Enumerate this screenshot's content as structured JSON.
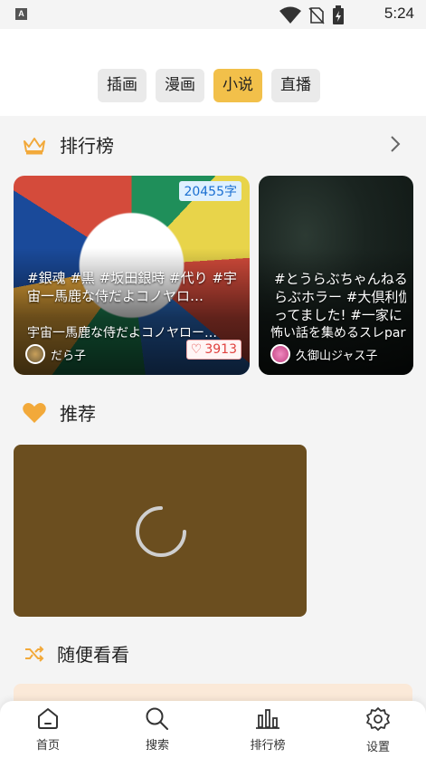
{
  "status_bar": {
    "app_badge": "A",
    "time": "5:24"
  },
  "tabs": [
    {
      "label": "插画",
      "active": false
    },
    {
      "label": "漫画",
      "active": false
    },
    {
      "label": "小说",
      "active": true
    },
    {
      "label": "直播",
      "active": false
    }
  ],
  "ranking": {
    "title": "排行榜",
    "cards": [
      {
        "word_count": "20455字",
        "tags": "#銀魂 #黒 #坂田銀時 #代り #宇宙一馬鹿な侍だよコノヤロ…",
        "subtitle": "宇宙一馬鹿な侍だよコノヤロー…",
        "author": "だら子",
        "likes": "3913"
      },
      {
        "tags_line1": "#とうらぶちゃんねる",
        "tags_line2": "らぶホラー #大倶利伽",
        "tags_line3": "ってました! #一家に",
        "subtitle": "怖い話を集めるスレpart",
        "author": "久御山ジャス子"
      }
    ]
  },
  "recommend": {
    "title": "推荐"
  },
  "random": {
    "title": "随便看看"
  },
  "bottom_nav": [
    {
      "label": "首页",
      "icon": "home-icon"
    },
    {
      "label": "搜索",
      "icon": "search-icon"
    },
    {
      "label": "排行榜",
      "icon": "bar-chart-icon"
    },
    {
      "label": "设置",
      "icon": "gear-icon"
    }
  ],
  "colors": {
    "accent": "#f2c04a",
    "like": "#e0423f",
    "wordcount": "#1a6fd1",
    "recommend_card": "#6b4e1f"
  }
}
